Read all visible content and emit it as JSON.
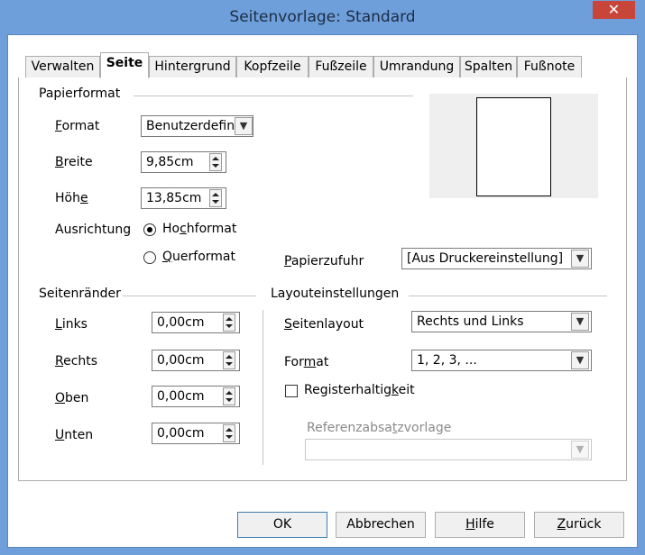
{
  "window": {
    "title": "Seitenvorlage: Standard",
    "close_glyph": "✕"
  },
  "tabs": [
    {
      "label": "Verwalten"
    },
    {
      "label": "Seite",
      "active": true
    },
    {
      "label": "Hintergrund"
    },
    {
      "label": "Kopfzeile"
    },
    {
      "label": "Fußzeile"
    },
    {
      "label": "Umrandung"
    },
    {
      "label": "Spalten"
    },
    {
      "label": "Fußnote"
    }
  ],
  "paper": {
    "section": "Papierformat",
    "format_label": "Format",
    "format_value": "Benutzerdefin",
    "width_label": "Breite",
    "width_value": "9,85cm",
    "height_label": "Höhe",
    "height_value": "13,85cm",
    "orientation_label": "Ausrichtung",
    "portrait_label": "Hochformat",
    "landscape_label": "Querformat",
    "orientation_selected": "Hochformat",
    "tray_label": "Papierzufuhr",
    "tray_value": "[Aus Druckereinstellung]"
  },
  "margins": {
    "section": "Seitenränder",
    "left_label": "Links",
    "left_value": "0,00cm",
    "right_label": "Rechts",
    "right_value": "0,00cm",
    "top_label": "Oben",
    "top_value": "0,00cm",
    "bottom_label": "Unten",
    "bottom_value": "0,00cm"
  },
  "layout": {
    "section": "Layouteinstellungen",
    "page_layout_label": "Seitenlayout",
    "page_layout_value": "Rechts und Links",
    "format_label": "Format",
    "format_value": "1, 2, 3, ...",
    "register_label": "Registerhaltigkeit",
    "register_checked": false,
    "ref_style_label": "Referenzabsatzvorlage",
    "ref_style_value": ""
  },
  "buttons": {
    "ok": "OK",
    "cancel": "Abbrechen",
    "help": "Hilfe",
    "reset": "Zurück"
  },
  "colors": {
    "titlebar": "#6f9fdb",
    "close": "#c8453a",
    "default_button_border": "#3c7fb1"
  }
}
